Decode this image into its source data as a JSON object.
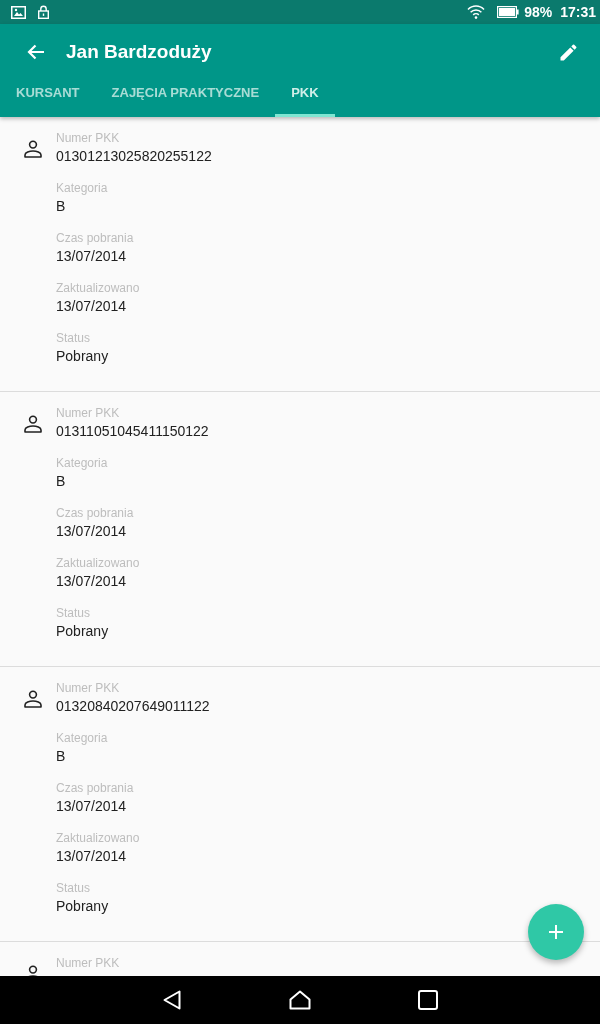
{
  "status_bar": {
    "battery": "98%",
    "time": "17:31"
  },
  "app_bar": {
    "title": "Jan Bardzoduży"
  },
  "tabs": [
    {
      "label": "KURSANT",
      "selected": false
    },
    {
      "label": "ZAJĘCIA PRAKTYCZNE",
      "selected": false
    },
    {
      "label": "PKK",
      "selected": true
    }
  ],
  "records": [
    {
      "fields": [
        {
          "label": "Numer PKK",
          "value": "01301213025820255122"
        },
        {
          "label": "Kategoria",
          "value": "B"
        },
        {
          "label": "Czas pobrania",
          "value": "13/07/2014"
        },
        {
          "label": "Zaktualizowano",
          "value": "13/07/2014"
        },
        {
          "label": "Status",
          "value": "Pobrany"
        }
      ]
    },
    {
      "fields": [
        {
          "label": "Numer PKK",
          "value": "01311051045411150122"
        },
        {
          "label": "Kategoria",
          "value": "B"
        },
        {
          "label": "Czas pobrania",
          "value": "13/07/2014"
        },
        {
          "label": "Zaktualizowano",
          "value": "13/07/2014"
        },
        {
          "label": "Status",
          "value": "Pobrany"
        }
      ]
    },
    {
      "fields": [
        {
          "label": "Numer PKK",
          "value": "01320840207649011122"
        },
        {
          "label": "Kategoria",
          "value": "B"
        },
        {
          "label": "Czas pobrania",
          "value": "13/07/2014"
        },
        {
          "label": "Zaktualizowano",
          "value": "13/07/2014"
        },
        {
          "label": "Status",
          "value": "Pobrany"
        }
      ]
    },
    {
      "fields": [
        {
          "label": "Numer PKK"
        }
      ]
    }
  ]
}
